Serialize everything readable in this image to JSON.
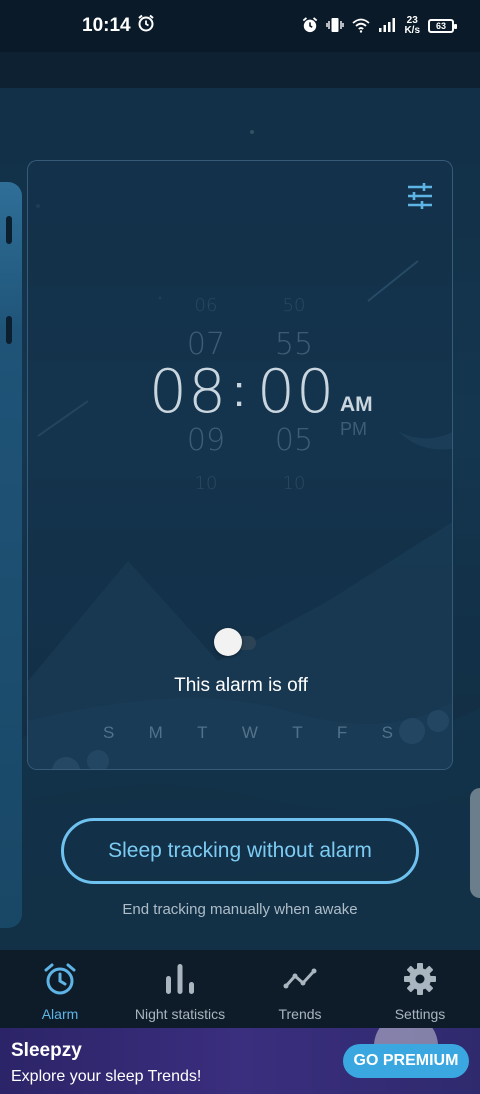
{
  "status_bar": {
    "time": "10:14",
    "net_speed_value": "23",
    "net_speed_unit": "K/s",
    "battery": "63",
    "icons": [
      "alarm-icon",
      "vibrate-icon",
      "wifi-icon",
      "signal-icon",
      "battery-icon"
    ]
  },
  "alarm": {
    "hour_above_2": "06",
    "hour_above_1": "07",
    "hour": "08",
    "hour_below_1": "09",
    "hour_below_2": "10",
    "minute_above_2": "50",
    "minute_above_1": "55",
    "minute": "00",
    "minute_below_1": "05",
    "minute_below_2": "10",
    "separator": ":",
    "am_label": "AM",
    "pm_label": "PM",
    "enabled": false,
    "status_text": "This alarm is off",
    "weekdays": [
      "S",
      "M",
      "T",
      "W",
      "T",
      "F",
      "S"
    ]
  },
  "cta": {
    "label": "Sleep tracking without alarm",
    "subtext": "End tracking manually when awake"
  },
  "nav": {
    "items": [
      {
        "label": "Alarm",
        "icon": "alarm-clock-icon",
        "active": true
      },
      {
        "label": "Night statistics",
        "icon": "bar-chart-icon",
        "active": false
      },
      {
        "label": "Trends",
        "icon": "trend-line-icon",
        "active": false
      },
      {
        "label": "Settings",
        "icon": "gear-icon",
        "active": false
      }
    ]
  },
  "promo": {
    "title": "Sleepzy",
    "subtitle": "Explore your sleep Trends!",
    "button_label": "GO PREMIUM"
  },
  "colors": {
    "accent": "#5fb4e6",
    "cta_border": "#6fc2ef",
    "background": "#0e2234",
    "nav_background": "#0e1c29",
    "premium_button": "#3aa7e0"
  }
}
